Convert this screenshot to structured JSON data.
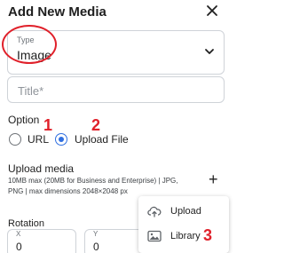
{
  "dialog": {
    "title": "Add New Media"
  },
  "type_field": {
    "label": "Type",
    "value": "Image"
  },
  "title_field": {
    "placeholder": "Title*"
  },
  "option": {
    "title": "Option",
    "choices": [
      {
        "label": "URL",
        "selected": false
      },
      {
        "label": "Upload File",
        "selected": true
      }
    ]
  },
  "upload": {
    "title": "Upload media",
    "description_line1": "10MB max (20MB for Business and Enterprise) | JPG,",
    "description_line2": "PNG | max dimensions 2048×2048 px"
  },
  "rotation": {
    "title": "Rotation",
    "x_label": "X",
    "x_value": "0",
    "y_label": "Y",
    "y_value": "0"
  },
  "upload_menu": {
    "items": [
      {
        "label": "Upload",
        "icon": "cloud-upload-icon"
      },
      {
        "label": "Library",
        "icon": "image-icon"
      }
    ]
  },
  "annotations": {
    "n1": "1",
    "n2": "2",
    "n3": "3"
  },
  "colors": {
    "accent": "#2f6fe0",
    "annotation_red": "#e0202a",
    "border": "#cfd3d8"
  }
}
